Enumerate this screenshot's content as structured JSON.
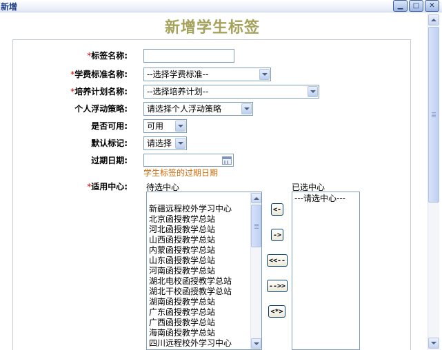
{
  "window": {
    "title": "新增",
    "controls": [
      {
        "name": "minimize-button",
        "glyph": "▁"
      },
      {
        "name": "maximize-button",
        "glyph": "□"
      },
      {
        "name": "close-button",
        "glyph": "✕"
      }
    ]
  },
  "page": {
    "title": "新增学生标签",
    "title_color": "#a5a35b"
  },
  "form": {
    "tag_name": {
      "required_mark": "*",
      "label": "标签名称:",
      "value": ""
    },
    "fee_standard": {
      "required_mark": "*",
      "label": "学费标准名称:",
      "selected": "--选择学费标准--"
    },
    "training_plan": {
      "required_mark": "*",
      "label": "培养计划名称:",
      "selected": "--选择培养计划--"
    },
    "float_policy": {
      "label": "个人浮动策略:",
      "selected": "请选择个人浮动策略"
    },
    "enabled": {
      "label": "是否可用:",
      "selected": "可用"
    },
    "default_mark": {
      "label": "默认标记:",
      "selected": "请选择"
    },
    "expire_date": {
      "label": "过期日期:",
      "value": "",
      "hint": "学生标签的过期日期",
      "hint_color": "#d06c0b"
    },
    "centers": {
      "required_mark": "*",
      "label": "适用中心:",
      "available_label": "待选中心",
      "selected_label": "已选中心",
      "available": [
        "新疆远程校外学习中心",
        "北京函授教学总站",
        "河北函授教学总站",
        "山西函授教学总站",
        "内蒙函授教学总站",
        "山东函授教学总站",
        "河南函授教学总站",
        "湖北电校函授教学总站",
        "湖北干校函授教学总站",
        "湖南函授教学总站",
        "广东函授教学总站",
        "广西函授教学总站",
        "海南函授教学总站",
        "四川远程校外学习中心"
      ],
      "selected": [
        "---请选中心---"
      ],
      "buttons": {
        "move_left": "<-",
        "move_right": "->",
        "move_all_left": "<<--",
        "move_all_right": "-->>",
        "special": "<*>"
      }
    }
  },
  "colors": {
    "required": "#cc0000",
    "title_bar_text": "#1f3f86"
  }
}
